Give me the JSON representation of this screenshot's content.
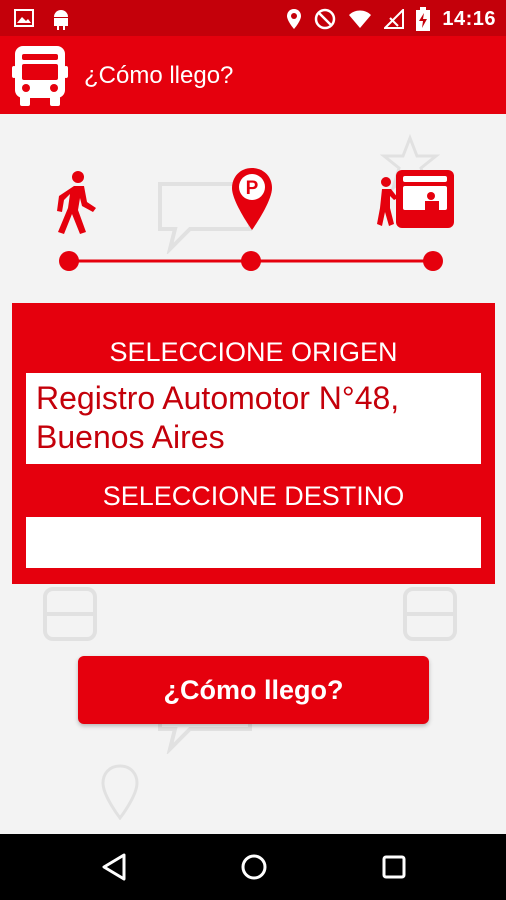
{
  "status_bar": {
    "time": "14:16",
    "icons": [
      "image-icon",
      "android-icon",
      "location-icon",
      "do-not-disturb-icon",
      "wifi-icon",
      "no-signal-icon",
      "battery-charging-icon"
    ]
  },
  "app_bar": {
    "title": "¿Cómo llego?",
    "icon": "bus-icon"
  },
  "steps": [
    "walk-icon",
    "parking-marker-icon",
    "boarding-bus-icon"
  ],
  "form": {
    "origin_label": "SELECCIONE ORIGEN",
    "origin_value": "Registro Automotor N°48, Buenos Aires",
    "destination_label": "SELECCIONE DESTINO",
    "destination_value": ""
  },
  "cta_label": "¿Cómo llego?",
  "colors": {
    "brand_red": "#e5000d",
    "status_red": "#c4000a",
    "text_red": "#c4000a",
    "background": "#f3f3f3"
  },
  "nav_bar": [
    "back-icon",
    "home-icon",
    "recents-icon"
  ]
}
